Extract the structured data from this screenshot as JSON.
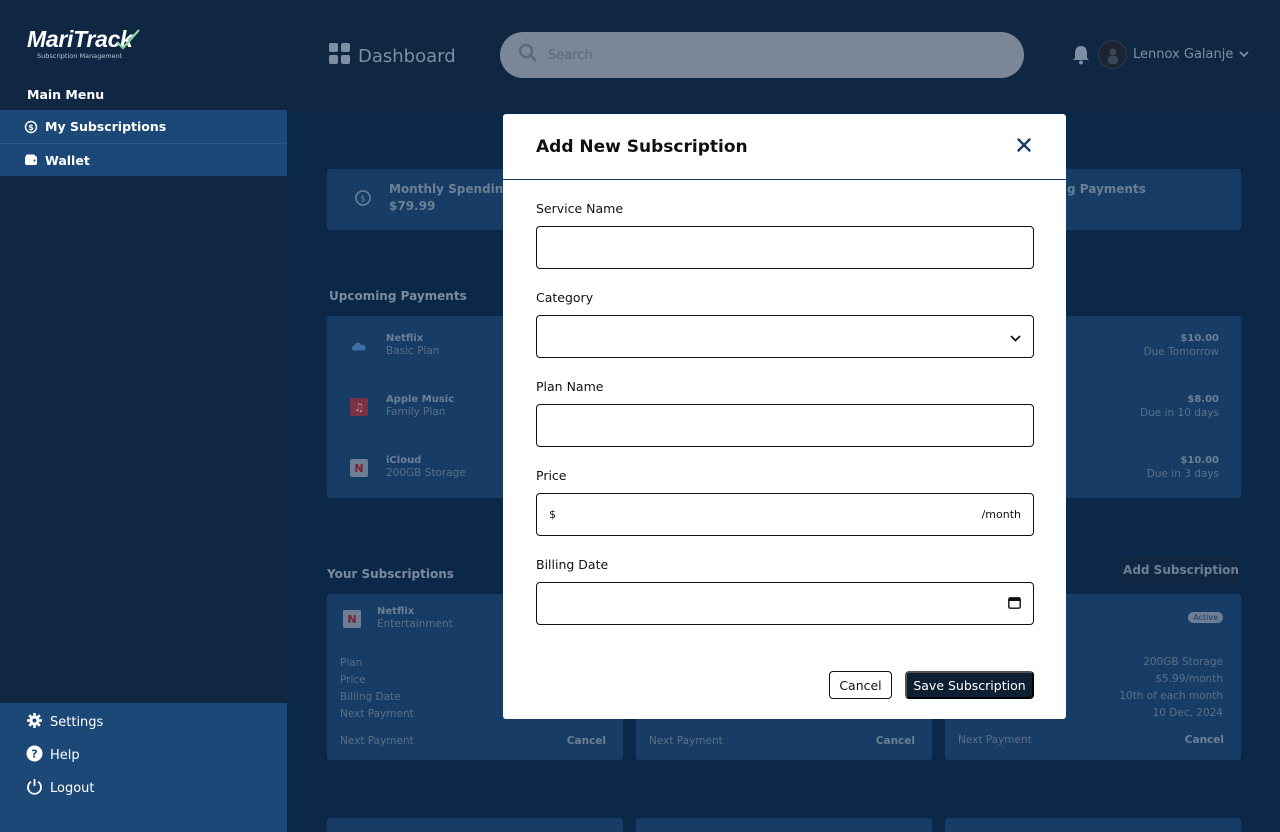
{
  "app": {
    "name": "MariTrack",
    "tagline": "Subscription Management"
  },
  "sidebar": {
    "heading": "Main Menu",
    "items": [
      {
        "label": "My Subscriptions",
        "icon": "dollar-cycle-icon"
      },
      {
        "label": "Wallet",
        "icon": "wallet-icon"
      }
    ],
    "bottom": [
      {
        "label": "Settings",
        "icon": "gear-icon"
      },
      {
        "label": "Help",
        "icon": "question-icon"
      },
      {
        "label": "Logout",
        "icon": "power-icon"
      }
    ]
  },
  "header": {
    "title": "Dashboard",
    "search_placeholder": "Search",
    "user_name": "Lennox Galanje"
  },
  "stats": {
    "monthly_label": "Monthly Spending",
    "monthly_value": "$79.99",
    "upcoming_label": "g Payments"
  },
  "upcoming": {
    "title": "Upcoming Payments",
    "rows": [
      {
        "name": "Netflix",
        "plan": "Basic Plan",
        "price": "$10.00",
        "due": "Due Tomorrow"
      },
      {
        "name": "Apple Music",
        "plan": "Family Plan",
        "price": "$8.00",
        "due": "Due in 10 days"
      },
      {
        "name": "iCloud",
        "plan": "200GB Storage",
        "price": "$10.00",
        "due": "Due in 3 days"
      }
    ]
  },
  "subscriptions": {
    "title": "Your Subscriptions",
    "add_button": "Add Subscription",
    "card1": {
      "name": "Netflix",
      "category": "Entertainment",
      "labels": [
        "Plan",
        "Price",
        "Billing Date",
        "Next Payment"
      ],
      "footer_label": "Next Payment",
      "cancel": "Cancel"
    },
    "card2": {
      "footer_label": "Next Payment",
      "cancel": "Cancel"
    },
    "card3": {
      "badge": "Active",
      "values": [
        "200GB Storage",
        "$5.99/month",
        "10th of each month",
        "10 Dec, 2024"
      ],
      "footer_label": "Next Payment",
      "cancel": "Cancel"
    }
  },
  "modal": {
    "title": "Add New Subscription",
    "service_label": "Service Name",
    "service_value": "",
    "category_label": "Category",
    "category_value": "",
    "plan_label": "Plan Name",
    "plan_value": "",
    "price_label": "Price",
    "price_prefix": "$",
    "price_suffix": "/month",
    "price_value": "",
    "billing_label": "Billing Date",
    "billing_value": "",
    "cancel_label": "Cancel",
    "save_label": "Save Subscription"
  },
  "colors": {
    "sidebar_bg": "#0f2743",
    "nav_active_bg": "#1c4877",
    "page_bg": "#0c2849",
    "card_bg": "#173d66",
    "primary_button": "#0f1f33"
  }
}
